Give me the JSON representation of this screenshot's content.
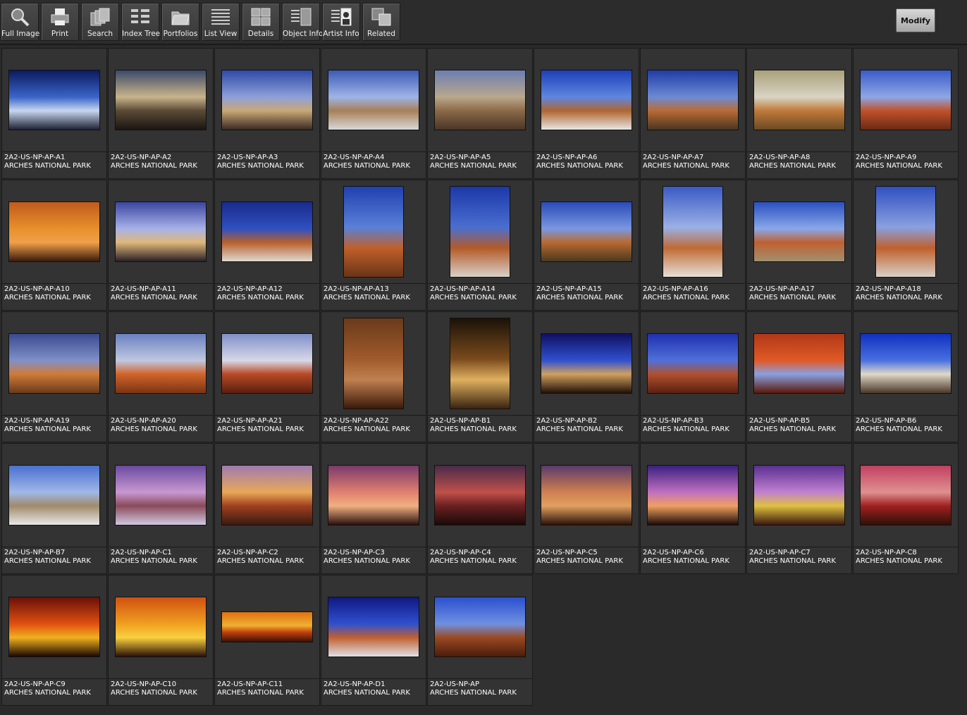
{
  "toolbar": {
    "buttons": [
      {
        "label": "Full Image",
        "icon": "magnifier-icon"
      },
      {
        "label": "Print",
        "icon": "printer-icon"
      },
      {
        "label": "Search",
        "icon": "search-stack-icon"
      },
      {
        "label": "Index Tree",
        "icon": "index-tree-icon"
      },
      {
        "label": "Portfolios",
        "icon": "folder-icon"
      },
      {
        "label": "List View",
        "icon": "list-view-icon"
      },
      {
        "label": "Details",
        "icon": "details-grid-icon"
      },
      {
        "label": "Object Info",
        "icon": "object-info-icon"
      },
      {
        "label": "Artist  Info",
        "icon": "artist-info-icon"
      },
      {
        "label": "Related",
        "icon": "related-icon"
      }
    ],
    "modify_label": "Modify"
  },
  "gallery": {
    "items": [
      {
        "id": "2A2-US-NP-AP-A1",
        "title": "ARCHES NATIONAL PARK",
        "orient": "h",
        "colors": [
          "#0c1a5e",
          "#3a64c8",
          "#c8d6ef",
          "#1d2236"
        ]
      },
      {
        "id": "2A2-US-NP-AP-A2",
        "title": "ARCHES NATIONAL PARK",
        "orient": "h",
        "colors": [
          "#3b4a6a",
          "#c9b48a",
          "#5b4a36",
          "#1a1612"
        ]
      },
      {
        "id": "2A2-US-NP-AP-A3",
        "title": "ARCHES NATIONAL PARK",
        "orient": "h",
        "colors": [
          "#2f4aa8",
          "#8ea0d8",
          "#c9a877",
          "#3a2a22"
        ]
      },
      {
        "id": "2A2-US-NP-AP-A4",
        "title": "ARCHES NATIONAL PARK",
        "orient": "h",
        "colors": [
          "#3d5bb5",
          "#9fb4e6",
          "#a77f58",
          "#d9d9d9"
        ]
      },
      {
        "id": "2A2-US-NP-AP-A5",
        "title": "ARCHES NATIONAL PARK",
        "orient": "h",
        "colors": [
          "#6c7eb0",
          "#b9a88d",
          "#8b6a48",
          "#4a3626"
        ]
      },
      {
        "id": "2A2-US-NP-AP-A6",
        "title": "ARCHES NATIONAL PARK",
        "orient": "h",
        "colors": [
          "#1e3fb8",
          "#5f86e0",
          "#b0652e",
          "#e6e6e6"
        ]
      },
      {
        "id": "2A2-US-NP-AP-A7",
        "title": "ARCHES NATIONAL PARK",
        "orient": "h",
        "colors": [
          "#1f3ca6",
          "#6d8ad4",
          "#b96b34",
          "#4a3622"
        ]
      },
      {
        "id": "2A2-US-NP-AP-A8",
        "title": "ARCHES NATIONAL PARK",
        "orient": "h",
        "colors": [
          "#a9a07a",
          "#d9d4c4",
          "#c07a3a",
          "#6a4a22"
        ]
      },
      {
        "id": "2A2-US-NP-AP-A9",
        "title": "ARCHES NATIONAL PARK",
        "orient": "h",
        "colors": [
          "#3b5bc8",
          "#8ea6e4",
          "#c0522a",
          "#6a2a16"
        ]
      },
      {
        "id": "2A2-US-NP-AP-A10",
        "title": "ARCHES NATIONAL PARK",
        "orient": "h",
        "colors": [
          "#c05a1c",
          "#e8902c",
          "#f0a04a",
          "#3a1a0c"
        ]
      },
      {
        "id": "2A2-US-NP-AP-A11",
        "title": "ARCHES NATIONAL PARK",
        "orient": "h",
        "colors": [
          "#3b46a0",
          "#a8b2e8",
          "#e0b87a",
          "#2a2026"
        ]
      },
      {
        "id": "2A2-US-NP-AP-A12",
        "title": "ARCHES NATIONAL PARK",
        "orient": "h",
        "colors": [
          "#1a2a8c",
          "#3050c0",
          "#b8602c",
          "#e0d8d0"
        ]
      },
      {
        "id": "2A2-US-NP-AP-A13",
        "title": "ARCHES NATIONAL PARK",
        "orient": "v",
        "colors": [
          "#2040b0",
          "#5a80d8",
          "#c0602a",
          "#6a3418"
        ]
      },
      {
        "id": "2A2-US-NP-AP-A14",
        "title": "ARCHES NATIONAL PARK",
        "orient": "v",
        "colors": [
          "#1c38a8",
          "#4a6ed0",
          "#b45a28",
          "#d8d0c8"
        ]
      },
      {
        "id": "2A2-US-NP-AP-A15",
        "title": "ARCHES NATIONAL PARK",
        "orient": "h",
        "colors": [
          "#2a4ab8",
          "#7a98e0",
          "#b86a30",
          "#4a3a20"
        ]
      },
      {
        "id": "2A2-US-NP-AP-A16",
        "title": "ARCHES NATIONAL PARK",
        "orient": "v",
        "colors": [
          "#3a5ac4",
          "#9ab0e6",
          "#c06a34",
          "#e6e0d8"
        ]
      },
      {
        "id": "2A2-US-NP-AP-A17",
        "title": "ARCHES NATIONAL PARK",
        "orient": "h",
        "colors": [
          "#2a50c0",
          "#8aa8e8",
          "#c06030",
          "#a09070"
        ]
      },
      {
        "id": "2A2-US-NP-AP-A18",
        "title": "ARCHES NATIONAL PARK",
        "orient": "v",
        "colors": [
          "#3050c0",
          "#8aa0e0",
          "#c0602c",
          "#d8d0c8"
        ]
      },
      {
        "id": "2A2-US-NP-AP-A19",
        "title": "ARCHES NATIONAL PARK",
        "orient": "h",
        "colors": [
          "#3a4a90",
          "#8090c8",
          "#d07a38",
          "#6a3a1c"
        ]
      },
      {
        "id": "2A2-US-NP-AP-A20",
        "title": "ARCHES NATIONAL PARK",
        "orient": "h",
        "colors": [
          "#6a80c0",
          "#c0c8e0",
          "#d0642a",
          "#7a3414"
        ]
      },
      {
        "id": "2A2-US-NP-AP-A21",
        "title": "ARCHES NATIONAL PARK",
        "orient": "h",
        "colors": [
          "#8090c8",
          "#d8d8e8",
          "#b84a26",
          "#5a1e10"
        ]
      },
      {
        "id": "2A2-US-NP-AP-A22",
        "title": "ARCHES NATIONAL PARK",
        "orient": "v",
        "colors": [
          "#6a3a1c",
          "#a05a2c",
          "#c08050",
          "#3a1a0a"
        ]
      },
      {
        "id": "2A2-US-NP-AP-B1",
        "title": "ARCHES NATIONAL PARK",
        "orient": "v",
        "colors": [
          "#1a1208",
          "#7a4a1c",
          "#e0b060",
          "#3a2410"
        ]
      },
      {
        "id": "2A2-US-NP-AP-B2",
        "title": "ARCHES NATIONAL PARK",
        "orient": "h",
        "colors": [
          "#101060",
          "#3050d0",
          "#d0a060",
          "#201008"
        ]
      },
      {
        "id": "2A2-US-NP-AP-B3",
        "title": "ARCHES NATIONAL PARK",
        "orient": "h",
        "colors": [
          "#2030b0",
          "#5070d8",
          "#b05030",
          "#5a2010"
        ]
      },
      {
        "id": "2A2-US-NP-AP-B5",
        "title": "ARCHES NATIONAL PARK",
        "orient": "h",
        "colors": [
          "#b03818",
          "#e05a26",
          "#8aa0e0",
          "#5a180a"
        ]
      },
      {
        "id": "2A2-US-NP-AP-B6",
        "title": "ARCHES NATIONAL PARK",
        "orient": "h",
        "colors": [
          "#1030c0",
          "#4a70e0",
          "#e0d8c8",
          "#4a3828"
        ]
      },
      {
        "id": "2A2-US-NP-AP-B7",
        "title": "ARCHES NATIONAL PARK",
        "orient": "h",
        "colors": [
          "#4a70d0",
          "#a0b8e8",
          "#a08a6a",
          "#e8e8e8"
        ]
      },
      {
        "id": "2A2-US-NP-AP-C1",
        "title": "ARCHES NATIONAL PARK",
        "orient": "h",
        "colors": [
          "#6a4aa0",
          "#c898d0",
          "#8a4a5a",
          "#d0c8e0"
        ]
      },
      {
        "id": "2A2-US-NP-AP-C2",
        "title": "ARCHES NATIONAL PARK",
        "orient": "h",
        "colors": [
          "#a07ab0",
          "#e8a858",
          "#a04020",
          "#3a1a10"
        ]
      },
      {
        "id": "2A2-US-NP-AP-C3",
        "title": "ARCHES NATIONAL PARK",
        "orient": "h",
        "colors": [
          "#7a3a6a",
          "#e08070",
          "#f0b080",
          "#2a1010"
        ]
      },
      {
        "id": "2A2-US-NP-AP-C4",
        "title": "ARCHES NATIONAL PARK",
        "orient": "h",
        "colors": [
          "#4a2a4a",
          "#c0504a",
          "#6a2020",
          "#1a0a08"
        ]
      },
      {
        "id": "2A2-US-NP-AP-C5",
        "title": "ARCHES NATIONAL PARK",
        "orient": "h",
        "colors": [
          "#5a3a6a",
          "#d08050",
          "#e0a060",
          "#2a1208"
        ]
      },
      {
        "id": "2A2-US-NP-AP-C6",
        "title": "ARCHES NATIONAL PARK",
        "orient": "h",
        "colors": [
          "#3a2080",
          "#c070c0",
          "#f0a060",
          "#1a0a08"
        ]
      },
      {
        "id": "2A2-US-NP-AP-C7",
        "title": "ARCHES NATIONAL PARK",
        "orient": "h",
        "colors": [
          "#5a3090",
          "#c080d0",
          "#e0c040",
          "#3a1810"
        ]
      },
      {
        "id": "2A2-US-NP-AP-C8",
        "title": "ARCHES NATIONAL PARK",
        "orient": "h",
        "colors": [
          "#c04060",
          "#e09090",
          "#a02020",
          "#301008"
        ]
      },
      {
        "id": "2A2-US-NP-AP-C9",
        "title": "ARCHES NATIONAL PARK",
        "orient": "h",
        "colors": [
          "#6a1008",
          "#e05010",
          "#f0b020",
          "#1a0804"
        ]
      },
      {
        "id": "2A2-US-NP-AP-C10",
        "title": "ARCHES NATIONAL PARK",
        "orient": "h",
        "colors": [
          "#d05010",
          "#f0a020",
          "#f8d040",
          "#2a1008"
        ]
      },
      {
        "id": "2A2-US-NP-AP-C11",
        "title": "ARCHES NATIONAL PARK",
        "orient": "p",
        "colors": [
          "#e07010",
          "#f0b030",
          "#c04010",
          "#3a1008"
        ]
      },
      {
        "id": "2A2-US-NP-AP-D1",
        "title": "ARCHES NATIONAL PARK",
        "orient": "h",
        "colors": [
          "#101880",
          "#3050d0",
          "#c06030",
          "#e0e0e8"
        ]
      },
      {
        "id": "2A2-US-NP-AP",
        "title": "ARCHES NATIONAL PARK",
        "orient": "h",
        "colors": [
          "#2a50d0",
          "#7090e0",
          "#9a4a22",
          "#4a1c0c"
        ]
      }
    ]
  }
}
